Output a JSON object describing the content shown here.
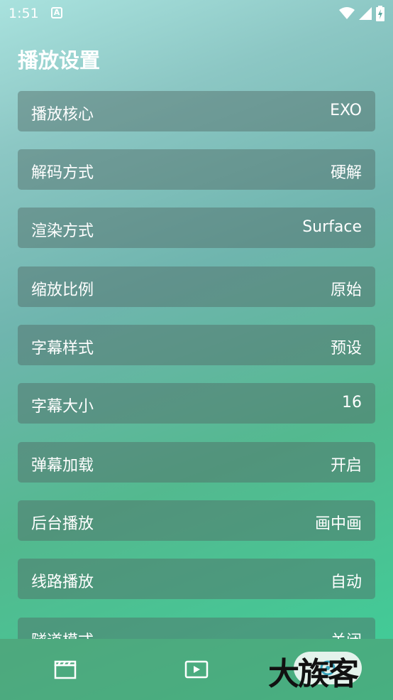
{
  "status_bar": {
    "time": "1:51",
    "notification_icon": "a-square-icon",
    "icons": [
      "wifi-icon",
      "signal-icon",
      "battery-charging-icon"
    ]
  },
  "page": {
    "title": "播放设置"
  },
  "settings": [
    {
      "label": "播放核心",
      "value": "EXO"
    },
    {
      "label": "解码方式",
      "value": "硬解"
    },
    {
      "label": "渲染方式",
      "value": "Surface"
    },
    {
      "label": "缩放比例",
      "value": "原始"
    },
    {
      "label": "字幕样式",
      "value": "预设"
    },
    {
      "label": "字幕大小",
      "value": "16"
    },
    {
      "label": "弹幕加载",
      "value": "开启"
    },
    {
      "label": "后台播放",
      "value": "画中画"
    },
    {
      "label": "线路播放",
      "value": "自动"
    },
    {
      "label": "隧道模式",
      "value": "关闭"
    }
  ],
  "bottom_nav": {
    "icons": [
      "film-icon",
      "play-icon",
      "settings-icon"
    ]
  },
  "watermark": {
    "text": "大族客"
  }
}
